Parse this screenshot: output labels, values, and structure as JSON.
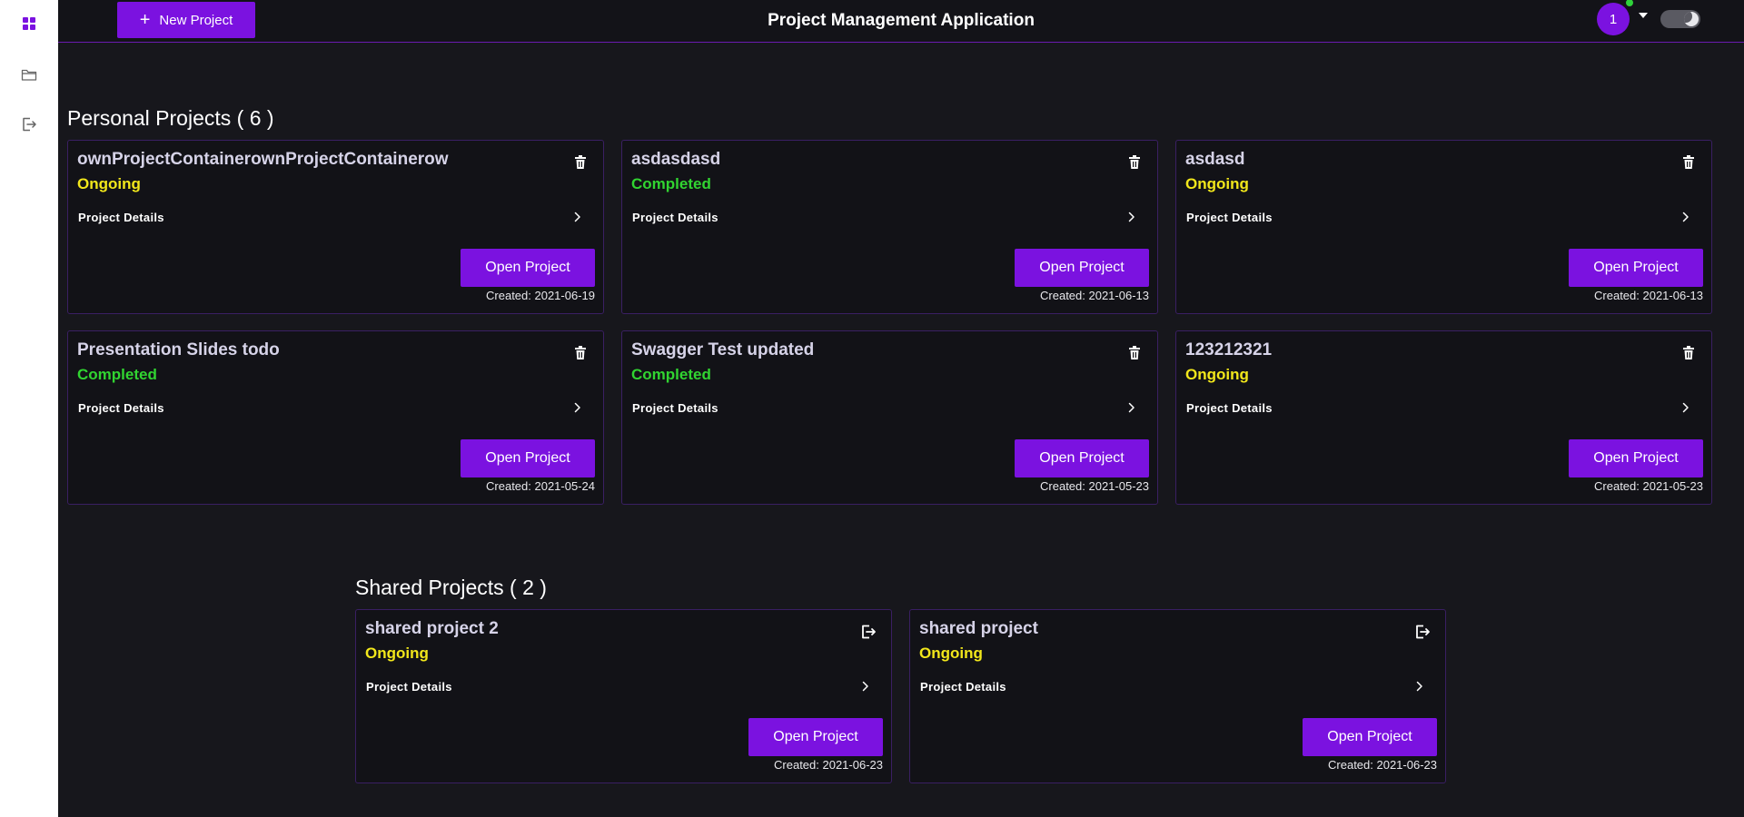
{
  "app": {
    "title": "Project Management Application"
  },
  "sidebar": {
    "items": [
      {
        "icon": "grid-icon",
        "active": true
      },
      {
        "icon": "folder-icon",
        "active": false
      },
      {
        "icon": "logout-icon",
        "active": false
      }
    ]
  },
  "header": {
    "new_project_label": "New Project",
    "avatar_initial": "1",
    "online": true
  },
  "personal": {
    "title": "Personal Projects ( 6 )",
    "projects": [
      {
        "title": "ownProjectContainerownProjectContainerow",
        "status": "Ongoing",
        "details": "Project Details",
        "open": "Open Project",
        "created": "Created: 2021-06-19"
      },
      {
        "title": "asdasdasd",
        "status": "Completed",
        "details": "Project Details",
        "open": "Open Project",
        "created": "Created: 2021-06-13"
      },
      {
        "title": "asdasd",
        "status": "Ongoing",
        "details": "Project Details",
        "open": "Open Project",
        "created": "Created: 2021-06-13"
      },
      {
        "title": "Presentation Slides todo",
        "status": "Completed",
        "details": "Project Details",
        "open": "Open Project",
        "created": "Created: 2021-05-24"
      },
      {
        "title": "Swagger Test updated",
        "status": "Completed",
        "details": "Project Details",
        "open": "Open Project",
        "created": "Created: 2021-05-23"
      },
      {
        "title": "123212321",
        "status": "Ongoing",
        "details": "Project Details",
        "open": "Open Project",
        "created": "Created: 2021-05-23"
      }
    ]
  },
  "shared": {
    "title": "Shared Projects ( 2 )",
    "projects": [
      {
        "title": "shared project 2",
        "status": "Ongoing",
        "details": "Project Details",
        "open": "Open Project",
        "created": "Created: 2021-06-23"
      },
      {
        "title": "shared project",
        "status": "Ongoing",
        "details": "Project Details",
        "open": "Open Project",
        "created": "Created: 2021-06-23"
      }
    ]
  },
  "colors": {
    "accent": "#7b12e0",
    "ongoing": "#f2e71b",
    "completed": "#31d431",
    "background": "#17171c"
  }
}
